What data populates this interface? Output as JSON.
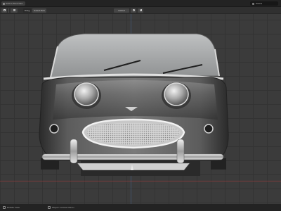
{
  "titlebar": {
    "window_label": "Add to Favorites",
    "scene_label": "Scene"
  },
  "header": {
    "editor_type_icon": "cube-icon",
    "mode": "Object Mode",
    "drag_label": "Drag",
    "select_box": "Select Box",
    "transform_orientation": "Global"
  },
  "viewport": {
    "options_label": "Object",
    "object": "Austin-Healey Sprite (front view, studio render)"
  },
  "statusbar": {
    "select_label": "Rotate View",
    "context_label": "Object Context Menu",
    "version": ""
  },
  "colors": {
    "viewport_bg": "#3b3b3b",
    "grid_line": "#333333",
    "x_axis": "#8e3c3c",
    "header_bg": "#303030",
    "titlebar_bg": "#232323"
  }
}
